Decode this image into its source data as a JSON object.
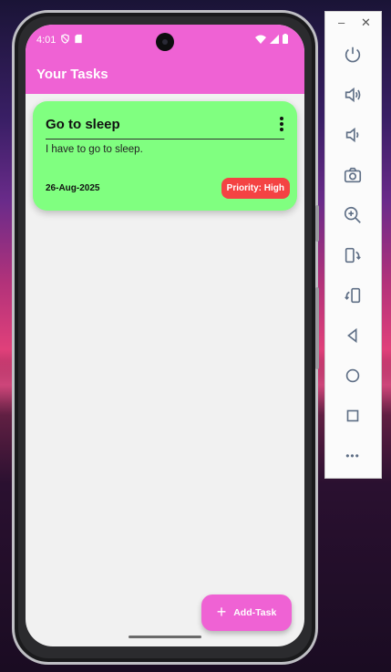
{
  "status_bar": {
    "time": "4:01"
  },
  "app_bar": {
    "title": "Your Tasks"
  },
  "tasks": [
    {
      "title": "Go to sleep",
      "description": "I have to go to sleep.",
      "date": "26-Aug-2025",
      "priority": "Priority: High"
    }
  ],
  "fab": {
    "label": "Add-Task"
  },
  "emulator_panel": {
    "minimize": "–",
    "close": "✕",
    "more": "•••"
  },
  "colors": {
    "primary": "#ef62d4",
    "card": "#80ff80",
    "priority_high": "#f44343",
    "background": "#f1f1f1"
  }
}
